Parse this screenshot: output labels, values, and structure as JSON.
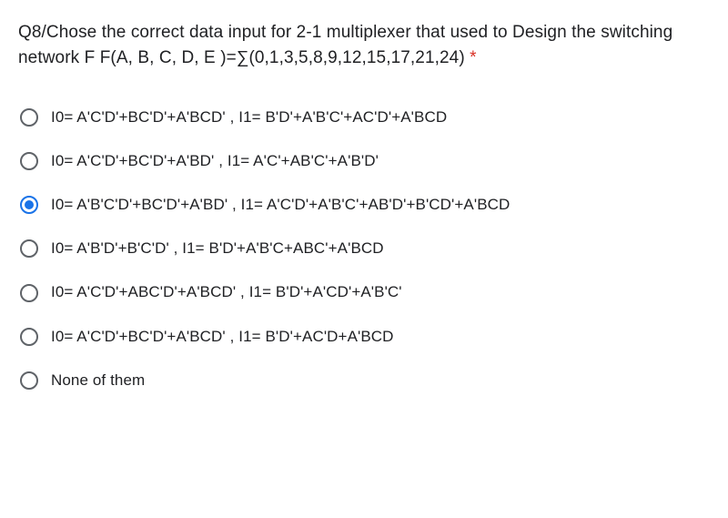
{
  "question": {
    "text": "Q8/Chose the correct data input for 2-1 multiplexer that used to Design the switching network F F(A, B, C, D, E )=∑(0,1,3,5,8,9,12,15,17,21,24)",
    "required_marker": "*"
  },
  "options": [
    {
      "label": "I0= A'C'D'+BC'D'+A'BCD' , I1= B'D'+A'B'C'+AC'D'+A'BCD",
      "selected": false
    },
    {
      "label": "I0= A'C'D'+BC'D'+A'BD' , I1= A'C'+AB'C'+A'B'D'",
      "selected": false
    },
    {
      "label": "I0= A'B'C'D'+BC'D'+A'BD' , I1= A'C'D'+A'B'C'+AB'D'+B'CD'+A'BCD",
      "selected": true
    },
    {
      "label": "I0= A'B'D'+B'C'D' , I1= B'D'+A'B'C+ABC'+A'BCD",
      "selected": false
    },
    {
      "label": "I0= A'C'D'+ABC'D'+A'BCD' , I1= B'D'+A'CD'+A'B'C'",
      "selected": false
    },
    {
      "label": "I0= A'C'D'+BC'D'+A'BCD' , I1= B'D'+AC'D+A'BCD",
      "selected": false
    },
    {
      "label": "None of them",
      "selected": false
    }
  ]
}
